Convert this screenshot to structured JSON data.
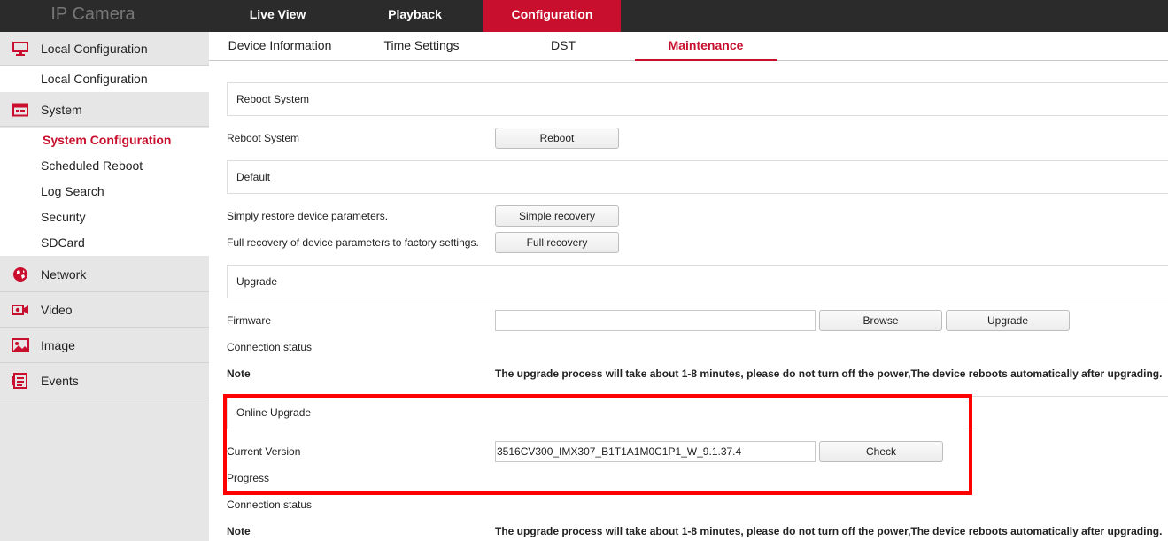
{
  "app": {
    "title": "IP Camera"
  },
  "topnav": {
    "items": [
      "Live View",
      "Playback",
      "Configuration"
    ],
    "active": "Configuration"
  },
  "sidebar": {
    "local_configuration": "Local Configuration",
    "local_configuration_sub": "Local Configuration",
    "system": "System",
    "system_items": [
      "System Configuration",
      "Scheduled Reboot",
      "Log Search",
      "Security",
      "SDCard"
    ],
    "network": "Network",
    "video": "Video",
    "image": "Image",
    "events": "Events"
  },
  "tabs": {
    "items": [
      "Device Information",
      "Time Settings",
      "DST",
      "Maintenance"
    ],
    "active": "Maintenance"
  },
  "reboot": {
    "header": "Reboot System",
    "label": "Reboot System",
    "button": "Reboot"
  },
  "default": {
    "header": "Default",
    "simple_label": "Simply restore device parameters.",
    "simple_button": "Simple recovery",
    "full_label": "Full recovery of device parameters to factory settings.",
    "full_button": "Full recovery"
  },
  "upgrade": {
    "header": "Upgrade",
    "firmware_label": "Firmware",
    "firmware_value": "",
    "browse_button": "Browse",
    "upgrade_button": "Upgrade",
    "connection_status": "Connection status",
    "note_label": "Note",
    "note_text": "The upgrade process will take about 1-8 minutes, please do not turn off the power,The device reboots automatically after upgrading."
  },
  "online_upgrade": {
    "header": "Online Upgrade",
    "current_version_label": "Current Version",
    "current_version_value": "3516CV300_IMX307_B1T1A1M0C1P1_W_9.1.37.4",
    "check_button": "Check",
    "progress_label": "Progress",
    "connection_status": "Connection status",
    "note_label": "Note",
    "note_text": "The upgrade process will take about 1-8 minutes, please do not turn off the power,The device reboots automatically after upgrading."
  },
  "colors": {
    "accent": "#c8102e",
    "topbar": "#2b2b2b",
    "sidebar": "#e6e6e6",
    "highlight": "#ff0000"
  }
}
